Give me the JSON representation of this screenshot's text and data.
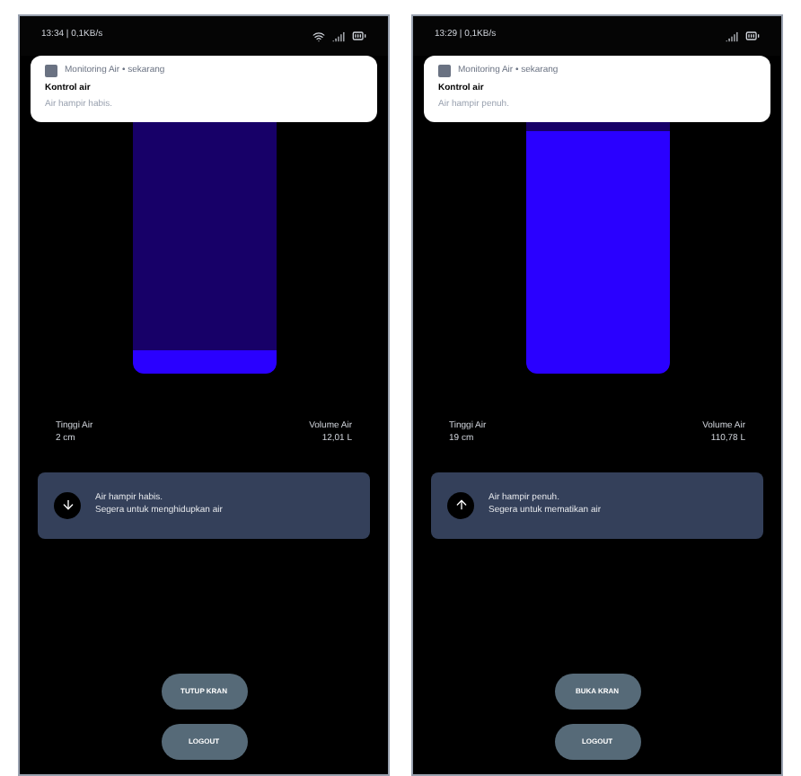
{
  "phones": [
    {
      "status_bar": {
        "time": "13:34 | 0,1KB/s",
        "wifi": true
      },
      "notification": {
        "app": "Monitoring Air • sekarang",
        "title": "Kontrol air",
        "body": "Air hampir habis."
      },
      "tank": {
        "level": 0.09
      },
      "readings": [
        {
          "label": "Tinggi Air",
          "value": "2 cm"
        },
        {
          "label": "Volume Air",
          "value": "12,01 L"
        }
      ],
      "alert": {
        "kind": "low",
        "lines": [
          "Air hampir habis.",
          "Segera untuk menghidupkan air"
        ]
      },
      "buttons": [
        "TUTUP KRAN",
        "LOGOUT"
      ]
    },
    {
      "status_bar": {
        "time": "13:29 | 0,1KB/s",
        "wifi": false
      },
      "notification": {
        "app": "Monitoring Air • sekarang",
        "title": "Kontrol air",
        "body": "Air hampir penuh."
      },
      "tank": {
        "level": 0.96
      },
      "readings": [
        {
          "label": "Tinggi Air",
          "value": "19 cm"
        },
        {
          "label": "Volume Air",
          "value": "110,78 L"
        }
      ],
      "alert": {
        "kind": "high",
        "lines": [
          "Air hampir penuh.",
          "Segera untuk mematikan air"
        ]
      },
      "buttons": [
        "BUKA KRAN",
        "LOGOUT"
      ]
    }
  ]
}
